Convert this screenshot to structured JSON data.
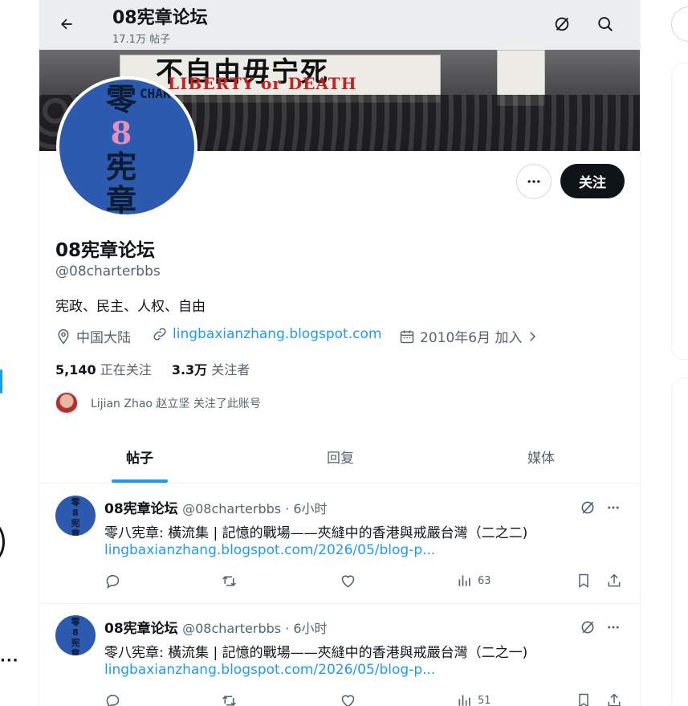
{
  "header": {
    "title": "08宪章论坛",
    "post_count": "17.1万 帖子"
  },
  "banner": {
    "slogan_en": "LIBERTY or DEATH",
    "slogan_cn": "不自由毋宁死"
  },
  "avatar_text": {
    "cn_line1": "零",
    "cn_line2": "8",
    "cn_line3": "宪",
    "cn_line4": "章",
    "en_vertical": "CHARTER08"
  },
  "profile": {
    "name": "08宪章论坛",
    "handle": "@08charterbbs",
    "bio": "宪政、民主、人权、自由",
    "location": "中国大陆",
    "website": "lingbaxianzhang.blogspot.com",
    "joined": "2010年6月 加入",
    "following_count": "5,140",
    "following_label": "正在关注",
    "followers_count": "3.3万",
    "followers_label": "关注者",
    "followed_by": "Lijian Zhao 赵立坚 关注了此账号",
    "follow_button": "关注"
  },
  "tabs": [
    {
      "label": "帖子",
      "active": true
    },
    {
      "label": "回复",
      "active": false
    },
    {
      "label": "媒体",
      "active": false
    }
  ],
  "posts": [
    {
      "name": "08宪章论坛",
      "meta": "@08charterbbs · 6小时",
      "text": "零八宪章: 橫流集 | 記憶的戰場——夾縫中的香港與戒嚴台灣（二之二)",
      "link": "lingbaxianzhang.blogspot.com/2026/05/blog-p...",
      "views": "63"
    },
    {
      "name": "08宪章论坛",
      "meta": "@08charterbbs · 6小时",
      "text": "零八宪章: 橫流集 | 記憶的戰場——夾縫中的香港與戒嚴台灣（二之一)",
      "link": "lingbaxianzhang.blogspot.com/2026/05/blog-p...",
      "views": "51"
    }
  ],
  "colors": {
    "accent": "#1d9bf0",
    "text": "#0f1419",
    "muted": "#536471",
    "avatar_blue": "#2b5aaf"
  },
  "icons": [
    "back-arrow-icon",
    "grok-icon",
    "search-icon",
    "more-icon",
    "location-icon",
    "link-icon",
    "calendar-icon",
    "chevron-right-icon",
    "reply-icon",
    "retweet-icon",
    "like-icon",
    "views-icon",
    "bookmark-icon",
    "share-icon"
  ]
}
